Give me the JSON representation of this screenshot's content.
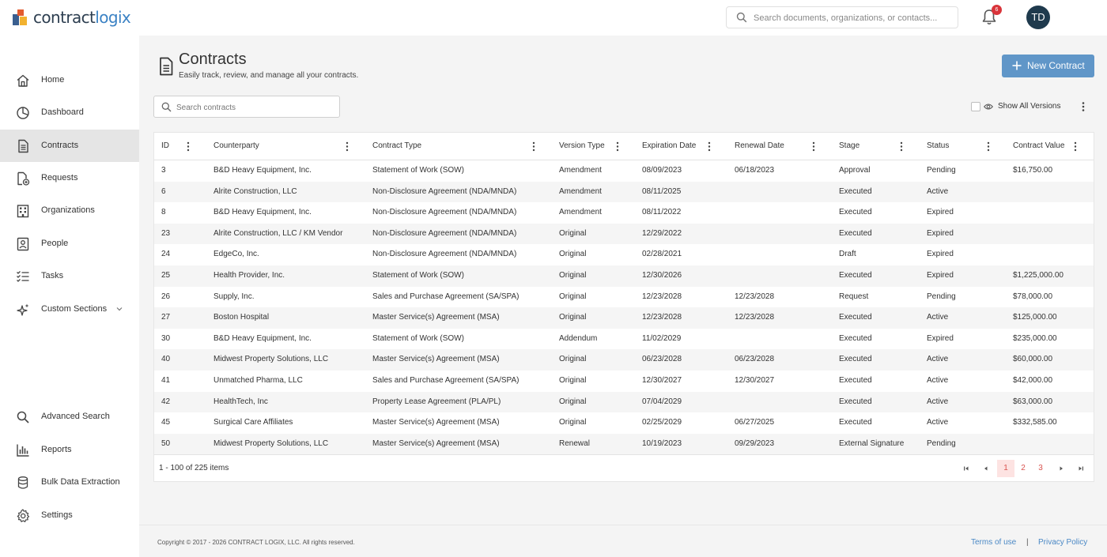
{
  "header": {
    "logo_part1": "contract",
    "logo_part2": "logix",
    "search_placeholder": "Search documents, organizations, or contacts...",
    "notification_count": "6",
    "avatar_initials": "TD"
  },
  "sidebar": {
    "top_items": [
      {
        "label": "Home",
        "icon": "home-icon"
      },
      {
        "label": "Dashboard",
        "icon": "pie-chart-icon"
      },
      {
        "label": "Contracts",
        "icon": "document-icon",
        "active": true
      },
      {
        "label": "Requests",
        "icon": "document-add-icon"
      },
      {
        "label": "Organizations",
        "icon": "building-icon"
      },
      {
        "label": "People",
        "icon": "person-icon"
      },
      {
        "label": "Tasks",
        "icon": "checklist-icon"
      },
      {
        "label": "Custom Sections",
        "icon": "sparkle-icon"
      }
    ],
    "bottom_items": [
      {
        "label": "Advanced Search",
        "icon": "search-icon"
      },
      {
        "label": "Reports",
        "icon": "bar-chart-icon"
      },
      {
        "label": "Bulk Data Extraction",
        "icon": "database-icon"
      },
      {
        "label": "Settings",
        "icon": "gear-icon"
      }
    ]
  },
  "page": {
    "title": "Contracts",
    "subtitle": "Easily track, review, and manage all your contracts.",
    "new_button_label": "New Contract",
    "search_placeholder": "Search contracts",
    "show_versions_label": "Show All Versions"
  },
  "table": {
    "columns": [
      "ID",
      "Counterparty",
      "Contract Type",
      "Version Type",
      "Expiration Date",
      "Renewal Date",
      "Stage",
      "Status",
      "Contract Value"
    ],
    "rows": [
      [
        "3",
        "B&D Heavy Equipment, Inc.",
        "Statement of Work (SOW)",
        "Amendment",
        "08/09/2023",
        "06/18/2023",
        "Approval",
        "Pending",
        "$16,750.00"
      ],
      [
        "6",
        "Alrite Construction, LLC",
        "Non-Disclosure Agreement (NDA/MNDA)",
        "Amendment",
        "08/11/2025",
        "",
        "Executed",
        "Active",
        ""
      ],
      [
        "8",
        "B&D Heavy Equipment, Inc.",
        "Non-Disclosure Agreement (NDA/MNDA)",
        "Amendment",
        "08/11/2022",
        "",
        "Executed",
        "Expired",
        ""
      ],
      [
        "23",
        "Alrite Construction, LLC / KM Vendor",
        "Non-Disclosure Agreement (NDA/MNDA)",
        "Original",
        "12/29/2022",
        "",
        "Executed",
        "Expired",
        ""
      ],
      [
        "24",
        "EdgeCo,  Inc.",
        "Non-Disclosure Agreement (NDA/MNDA)",
        "Original",
        "02/28/2021",
        "",
        "Draft",
        "Expired",
        ""
      ],
      [
        "25",
        "Health Provider, Inc.",
        "Statement of Work (SOW)",
        "Original",
        "12/30/2026",
        "",
        "Executed",
        "Expired",
        "$1,225,000.00"
      ],
      [
        "26",
        "Supply, Inc.",
        "Sales and Purchase Agreement (SA/SPA)",
        "Original",
        "12/23/2028",
        "12/23/2028",
        "Request",
        "Pending",
        "$78,000.00"
      ],
      [
        "27",
        "Boston Hospital",
        "Master Service(s) Agreement (MSA)",
        "Original",
        "12/23/2028",
        "12/23/2028",
        "Executed",
        "Active",
        "$125,000.00"
      ],
      [
        "30",
        "B&D Heavy Equipment, Inc.",
        "Statement of Work (SOW)",
        "Addendum",
        "11/02/2029",
        "",
        "Executed",
        "Expired",
        "$235,000.00"
      ],
      [
        "40",
        "Midwest Property Solutions, LLC",
        "Master Service(s) Agreement (MSA)",
        "Original",
        "06/23/2028",
        "06/23/2028",
        "Executed",
        "Active",
        "$60,000.00"
      ],
      [
        "41",
        "Unmatched Pharma, LLC",
        "Sales and Purchase Agreement (SA/SPA)",
        "Original",
        "12/30/2027",
        "12/30/2027",
        "Executed",
        "Active",
        "$42,000.00"
      ],
      [
        "42",
        "HealthTech, Inc",
        "Property Lease Agreement (PLA/PL)",
        "Original",
        "07/04/2029",
        "",
        "Executed",
        "Active",
        "$63,000.00"
      ],
      [
        "45",
        "Surgical Care Affiliates",
        "Master Service(s) Agreement (MSA)",
        "Original",
        "02/25/2029",
        "06/27/2025",
        "Executed",
        "Active",
        "$332,585.00"
      ],
      [
        "50",
        "Midwest Property Solutions, LLC",
        "Master Service(s) Agreement (MSA)",
        "Renewal",
        "10/19/2023",
        "09/29/2023",
        "External Signature",
        "Pending",
        ""
      ]
    ]
  },
  "pager": {
    "info": "1 - 100 of 225 items",
    "pages": [
      "1",
      "2",
      "3"
    ],
    "current": "1"
  },
  "footer": {
    "copyright": "Copyright © 2017 - 2026 CONTRACT LOGIX, LLC. All rights reserved.",
    "terms": "Terms of use",
    "separator": "|",
    "privacy": "Privacy Policy"
  },
  "colors": {
    "accent": "#6096c8",
    "link": "#4a88c5",
    "pager": "#d9534f",
    "avatar": "#1f3a4d"
  }
}
